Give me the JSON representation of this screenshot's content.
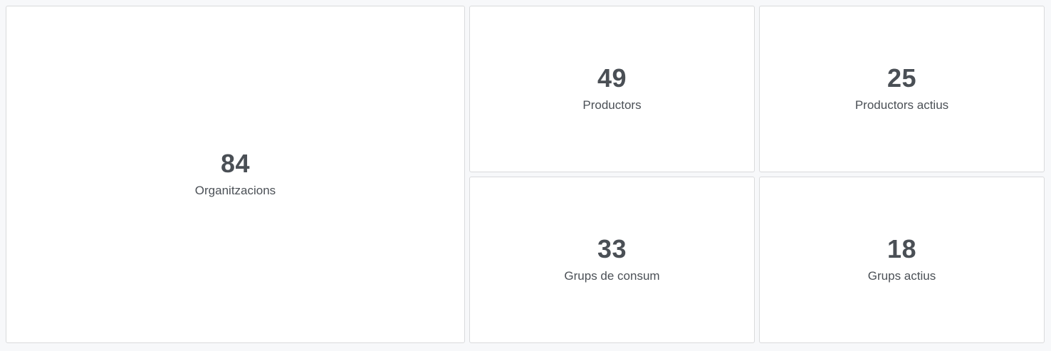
{
  "stats": {
    "organizations": {
      "value": "84",
      "label": "Organitzacions"
    },
    "producers": {
      "value": "49",
      "label": "Productors"
    },
    "active_producers": {
      "value": "25",
      "label": "Productors actius"
    },
    "consumer_groups": {
      "value": "33",
      "label": "Grups de consum"
    },
    "active_groups": {
      "value": "18",
      "label": "Grups actius"
    }
  },
  "colors": {
    "background": "#f7f8fa",
    "card": "#ffffff",
    "border": "#d9dadc",
    "text": "#4a4f55"
  }
}
